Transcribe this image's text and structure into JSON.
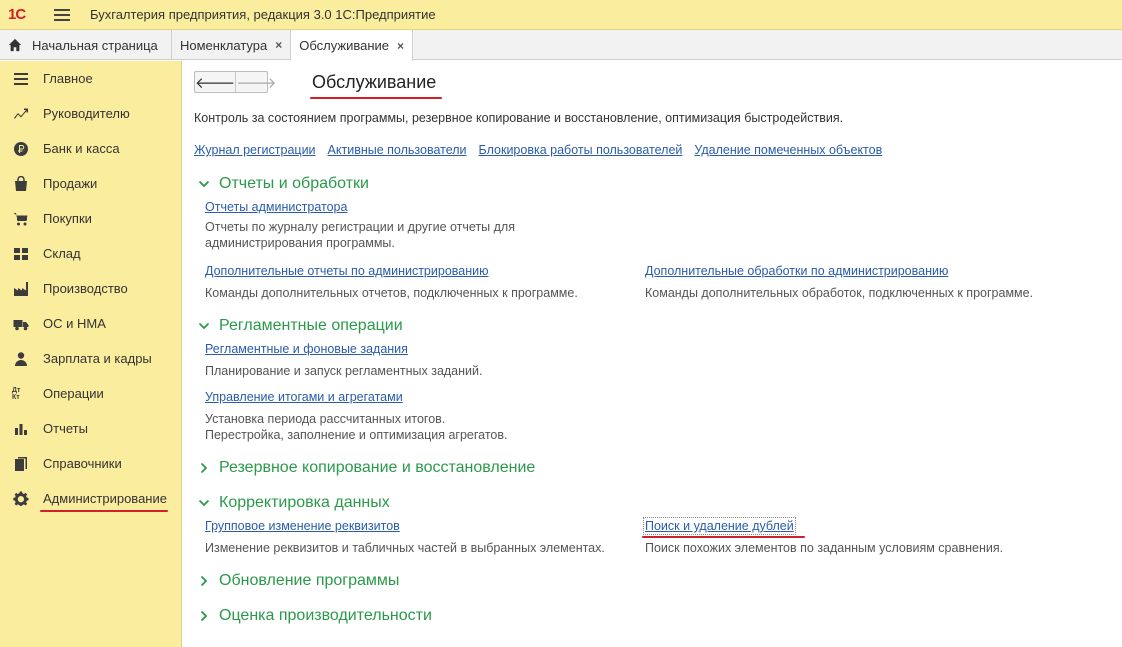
{
  "window": {
    "logo_text": "1С",
    "title": "Бухгалтерия предприятия, редакция 3.0 1С:Предприятие"
  },
  "tabs": [
    {
      "label": "Начальная страница"
    },
    {
      "label": "Номенклатура",
      "close": "×"
    },
    {
      "label": "Обслуживание",
      "close": "×"
    }
  ],
  "sidebar": {
    "items": [
      {
        "label": "Главное",
        "icon": "menu-lines-icon"
      },
      {
        "label": "Руководителю",
        "icon": "trend-icon"
      },
      {
        "label": "Банк и касса",
        "icon": "ruble-icon"
      },
      {
        "label": "Продажи",
        "icon": "shopping-bag-icon"
      },
      {
        "label": "Покупки",
        "icon": "cart-icon"
      },
      {
        "label": "Склад",
        "icon": "warehouse-icon"
      },
      {
        "label": "Производство",
        "icon": "factory-icon"
      },
      {
        "label": "ОС и НМА",
        "icon": "truck-icon"
      },
      {
        "label": "Зарплата и кадры",
        "icon": "person-icon"
      },
      {
        "label": "Операции",
        "icon": "debit-credit-icon",
        "icon_text": "Дт Кт"
      },
      {
        "label": "Отчеты",
        "icon": "bar-chart-icon"
      },
      {
        "label": "Справочники",
        "icon": "books-icon"
      },
      {
        "label": "Администрирование",
        "icon": "gear-icon"
      }
    ]
  },
  "main": {
    "back": "🡐",
    "forward": "🡒",
    "title": "Обслуживание",
    "description": "Контроль за состоянием программы, резервное копирование и восстановление, оптимизация быстродействия.",
    "top_links": [
      "Журнал регистрации",
      "Активные пользователи",
      "Блокировка работы пользователей",
      "Удаление помеченных объектов"
    ],
    "sections": {
      "reports": {
        "title": "Отчеты и обработки",
        "admin_reports": {
          "link": "Отчеты администратора",
          "note": "Отчеты по журналу регистрации и другие отчеты для\nадминистрирования программы."
        },
        "extra_reports": {
          "link": "Дополнительные отчеты по администрированию",
          "note": "Команды дополнительных отчетов, подключенных к программе."
        },
        "extra_processing": {
          "link": "Дополнительные обработки по администрированию",
          "note": "Команды дополнительных обработок, подключенных к программе."
        }
      },
      "routine": {
        "title": "Регламентные операции",
        "tasks": {
          "link": "Регламентные и фоновые задания",
          "note": "Планирование и запуск регламентных заданий."
        },
        "totals": {
          "link": "Управление итогами и агрегатами",
          "note": "Установка периода рассчитанных итогов.\nПерестройка, заполнение и оптимизация агрегатов."
        }
      },
      "backup": {
        "title": "Резервное копирование и восстановление"
      },
      "correction": {
        "title": "Корректировка данных",
        "group_change": {
          "link": "Групповое изменение реквизитов",
          "note": "Изменение реквизитов и табличных частей в выбранных элементах."
        },
        "duplicates": {
          "link": "Поиск и удаление дублей",
          "note": "Поиск похожих элементов по заданным условиям сравнения."
        }
      },
      "update": {
        "title": "Обновление программы"
      },
      "performance": {
        "title": "Оценка производительности"
      }
    }
  },
  "colors": {
    "accent_yellow": "#fbed9e",
    "section_green": "#2a9a4a",
    "link_blue": "#2a5caa",
    "highlight_red": "#d0202a"
  }
}
